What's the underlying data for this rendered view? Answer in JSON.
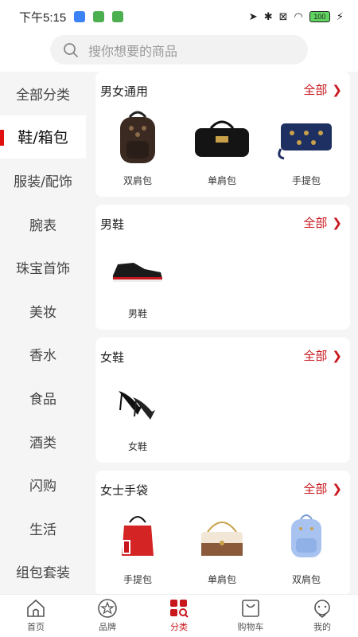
{
  "status_bar": {
    "time": "下午5:15",
    "battery": "100"
  },
  "search": {
    "placeholder": "搜你想要的商品"
  },
  "sidebar": {
    "items": [
      {
        "label": "全部分类",
        "active": false
      },
      {
        "label": "鞋/箱包",
        "active": true
      },
      {
        "label": "服装/配饰",
        "active": false
      },
      {
        "label": "腕表",
        "active": false
      },
      {
        "label": "珠宝首饰",
        "active": false
      },
      {
        "label": "美妆",
        "active": false
      },
      {
        "label": "香水",
        "active": false
      },
      {
        "label": "食品",
        "active": false
      },
      {
        "label": "酒类",
        "active": false
      },
      {
        "label": "闪购",
        "active": false
      },
      {
        "label": "生活",
        "active": false
      },
      {
        "label": "组包套装",
        "active": false
      }
    ]
  },
  "sections": [
    {
      "title": "男女通用",
      "all_label": "全部",
      "items": [
        {
          "label": "双肩包",
          "icon": "backpack-brown"
        },
        {
          "label": "单肩包",
          "icon": "duffel-black"
        },
        {
          "label": "手提包",
          "icon": "pouch-navy"
        }
      ]
    },
    {
      "title": "男鞋",
      "all_label": "全部",
      "items": [
        {
          "label": "男鞋",
          "icon": "sneaker-black"
        }
      ]
    },
    {
      "title": "女鞋",
      "all_label": "全部",
      "items": [
        {
          "label": "女鞋",
          "icon": "heels-black"
        }
      ]
    },
    {
      "title": "女士手袋",
      "all_label": "全部",
      "items": [
        {
          "label": "手提包",
          "icon": "bucket-red"
        },
        {
          "label": "单肩包",
          "icon": "shoulder-beige"
        },
        {
          "label": "双肩包",
          "icon": "backpack-blue"
        }
      ]
    }
  ],
  "tabbar": {
    "items": [
      {
        "label": "首页",
        "icon": "home-icon",
        "active": false
      },
      {
        "label": "品牌",
        "icon": "star-icon",
        "active": false
      },
      {
        "label": "分类",
        "icon": "category-icon",
        "active": true
      },
      {
        "label": "购物车",
        "icon": "cart-icon",
        "active": false
      },
      {
        "label": "我的",
        "icon": "profile-icon",
        "active": false
      }
    ]
  },
  "colors": {
    "accent": "#c8161d",
    "sidebar_bg": "#f5f5f5"
  }
}
